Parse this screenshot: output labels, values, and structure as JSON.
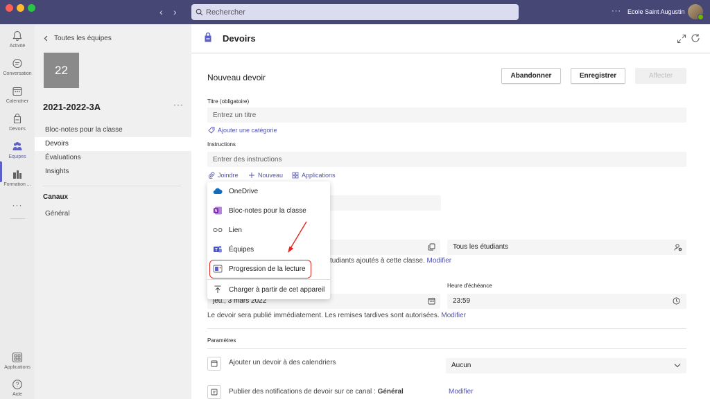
{
  "titlebar": {
    "search_placeholder": "Rechercher",
    "more": "···",
    "org_name": "Ecole Saint Augustin",
    "back_arrow": "‹",
    "forward_arrow": "›"
  },
  "rail": {
    "items": [
      {
        "label": "Activité",
        "icon": "bell-icon"
      },
      {
        "label": "Conversation",
        "icon": "chat-icon"
      },
      {
        "label": "Calendrier",
        "icon": "calendar-icon"
      },
      {
        "label": "Devoirs",
        "icon": "assignments-icon"
      },
      {
        "label": "Équipes",
        "icon": "teams-icon"
      },
      {
        "label": "Formation ...",
        "icon": "formation-icon"
      },
      {
        "label": "···",
        "icon": "more-icon"
      }
    ],
    "bottom": [
      {
        "label": "Applications",
        "icon": "apps-icon"
      },
      {
        "label": "Aide",
        "icon": "help-icon"
      }
    ],
    "accent": "#5b5fc7"
  },
  "team": {
    "back_label": "Toutes les équipes",
    "tile": "22",
    "name": "2021-2022-3A",
    "more": "···",
    "nav": [
      "Bloc-notes pour la classe",
      "Devoirs",
      "Évaluations",
      "Insights"
    ],
    "active_nav": "Devoirs",
    "channels_heading": "Canaux",
    "channels": [
      "Général"
    ]
  },
  "header": {
    "title": "Devoirs"
  },
  "form": {
    "heading": "Nouveau devoir",
    "buttons": {
      "abandon": "Abandonner",
      "save": "Enregistrer",
      "assign": "Affecter"
    },
    "title_label": "Titre (obligatoire)",
    "title_placeholder": "Entrez un titre",
    "add_category": "Ajouter une catégorie",
    "instructions_label": "Instructions",
    "instructions_placeholder": "Entrer des instructions",
    "attach": "Joindre",
    "new": "Nouveau",
    "applications": "Applications",
    "students_value": "Tous les étudiants",
    "added_students_text": "tudiants ajoutés à cette classe.",
    "modify": "Modifier",
    "due_time_label": "Heure d'échéance",
    "due_date": "jeu., 3 mars 2022",
    "due_time": "23:59",
    "publish_text": "Le devoir sera publié immédiatement. Les remises tardives sont autorisées.",
    "settings_heading": "Paramètres",
    "calendar_text": "Ajouter un devoir à des calendriers",
    "calendar_value": "Aucun",
    "notify_text": "Publier des notifications de devoir sur ce canal :",
    "notify_channel": "Général",
    "notify_modify": "Modifier"
  },
  "menu": {
    "items": [
      {
        "label": "OneDrive",
        "icon": "onedrive-icon"
      },
      {
        "label": "Bloc-notes pour la classe",
        "icon": "onenote-icon"
      },
      {
        "label": "Lien",
        "icon": "link-icon"
      },
      {
        "label": "Équipes",
        "icon": "teams-icon"
      },
      {
        "label": "Progression de la lecture",
        "icon": "reading-progress-icon"
      },
      {
        "label": "Charger à partir de cet appareil",
        "icon": "upload-icon"
      }
    ],
    "highlighted": "Progression de la lecture",
    "highlight_color": "#e2261f"
  }
}
